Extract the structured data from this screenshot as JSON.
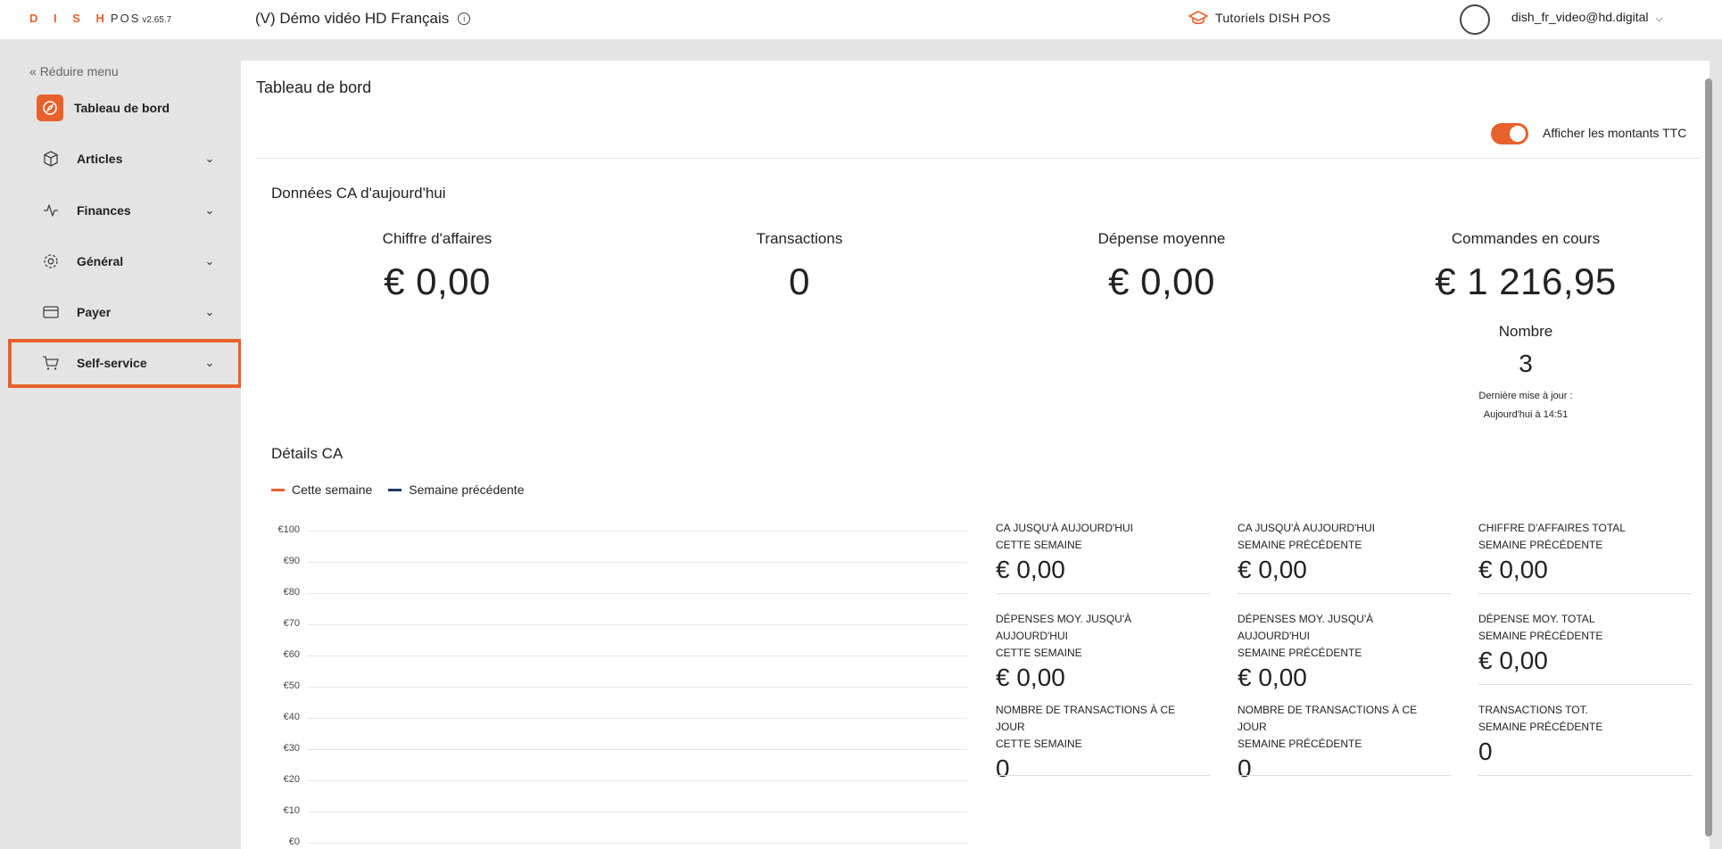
{
  "topbar": {
    "brand": "D I S H",
    "brand_pos": "POS",
    "version": "v2.65.7",
    "venue": "(V) Démo vidéo HD Français",
    "tutorials": "Tutoriels DISH POS",
    "user_email": "dish_fr_video@hd.digital"
  },
  "sidebar": {
    "collapse_label": "Réduire menu",
    "items": [
      {
        "label": "Tableau de bord",
        "icon": "compass-icon"
      },
      {
        "label": "Articles",
        "icon": "box-icon"
      },
      {
        "label": "Finances",
        "icon": "activity-icon"
      },
      {
        "label": "Général",
        "icon": "gear-icon"
      },
      {
        "label": "Payer",
        "icon": "credit-card-icon"
      },
      {
        "label": "Self-service",
        "icon": "cart-icon"
      }
    ]
  },
  "main": {
    "title": "Tableau de bord",
    "toggle_label": "Afficher les montants TTC",
    "toggle_on": true,
    "today_title": "Données CA d'aujourd'hui",
    "kpis": [
      {
        "label": "Chiffre d'affaires",
        "value": "€ 0,00"
      },
      {
        "label": "Transactions",
        "value": "0"
      },
      {
        "label": "Dépense moyenne",
        "value": "€ 0,00"
      },
      {
        "label": "Commandes en cours",
        "value": "€ 1 216,95"
      }
    ],
    "nombre_label": "Nombre",
    "nombre_value": "3",
    "last_update_line1": "Dernière mise à jour :",
    "last_update_line2": "Aujourd'hui à 14:51",
    "details_title": "Détails CA",
    "legend": [
      {
        "label": "Cette semaine",
        "color": "#e8612c"
      },
      {
        "label": "Semaine précédente",
        "color": "#1f3a6b"
      }
    ],
    "y_ticks": [
      "€100",
      "€90",
      "€80",
      "€70",
      "€60",
      "€50",
      "€40",
      "€30",
      "€20",
      "€10",
      "€0"
    ],
    "stats": [
      {
        "label": "CA jusqu'à aujourd'hui cette semaine",
        "l1": "CA JUSQU'À AUJOURD'HUI",
        "l2": "CETTE SEMAINE",
        "l3": "",
        "value": "€ 0,00"
      },
      {
        "label": "CA jusqu'à aujourd'hui semaine précédente",
        "l1": "CA JUSQU'À AUJOURD'HUI",
        "l2": "SEMAINE PRÉCÉDENTE",
        "l3": "",
        "value": "€ 0,00"
      },
      {
        "label": "Chiffre d'affaires total semaine précédente",
        "l1": "CHIFFRE D'AFFAIRES TOTAL",
        "l2": "SEMAINE PRÉCÉDENTE",
        "l3": "",
        "value": "€ 0,00"
      },
      {
        "label": "Dépenses moy. jusqu'à aujourd'hui cette semaine",
        "l1": "DÉPENSES MOY. JUSQU'À",
        "l2": "AUJOURD'HUI",
        "l3": "CETTE SEMAINE",
        "value": "€ 0,00"
      },
      {
        "label": "Dépenses moy. jusqu'à aujourd'hui semaine précédente",
        "l1": "DÉPENSES MOY. JUSQU'À",
        "l2": "AUJOURD'HUI",
        "l3": "SEMAINE PRÉCÉDENTE",
        "value": "€ 0,00"
      },
      {
        "label": "Dépense moy. total semaine précédente",
        "l1": "DÉPENSE MOY. TOTAL",
        "l2": "SEMAINE PRÉCÉDENTE",
        "l3": "",
        "value": "€ 0,00"
      },
      {
        "label": "Nombre de transactions à ce jour cette semaine",
        "l1": "NOMBRE DE TRANSACTIONS À CE",
        "l2": "JOUR",
        "l3": "CETTE SEMAINE",
        "value": "0"
      },
      {
        "label": "Nombre de transactions à ce jour semaine précédente",
        "l1": "NOMBRE DE TRANSACTIONS À CE",
        "l2": "JOUR",
        "l3": "SEMAINE PRÉCÉDENTE",
        "value": "0"
      },
      {
        "label": "Transactions tot. semaine précédente",
        "l1": "TRANSACTIONS TOT.",
        "l2": "SEMAINE PRÉCÉDENTE",
        "l3": "",
        "value": "0"
      }
    ]
  },
  "chart_data": {
    "type": "line",
    "title": "",
    "xlabel": "",
    "ylabel": "",
    "ylim": [
      0,
      100
    ],
    "y_tick_labels": [
      "€0",
      "€10",
      "€20",
      "€30",
      "€40",
      "€50",
      "€60",
      "€70",
      "€80",
      "€90",
      "€100"
    ],
    "series": [
      {
        "name": "Cette semaine",
        "values": []
      },
      {
        "name": "Semaine précédente",
        "values": []
      }
    ],
    "legend": "top-left",
    "grid": true
  }
}
